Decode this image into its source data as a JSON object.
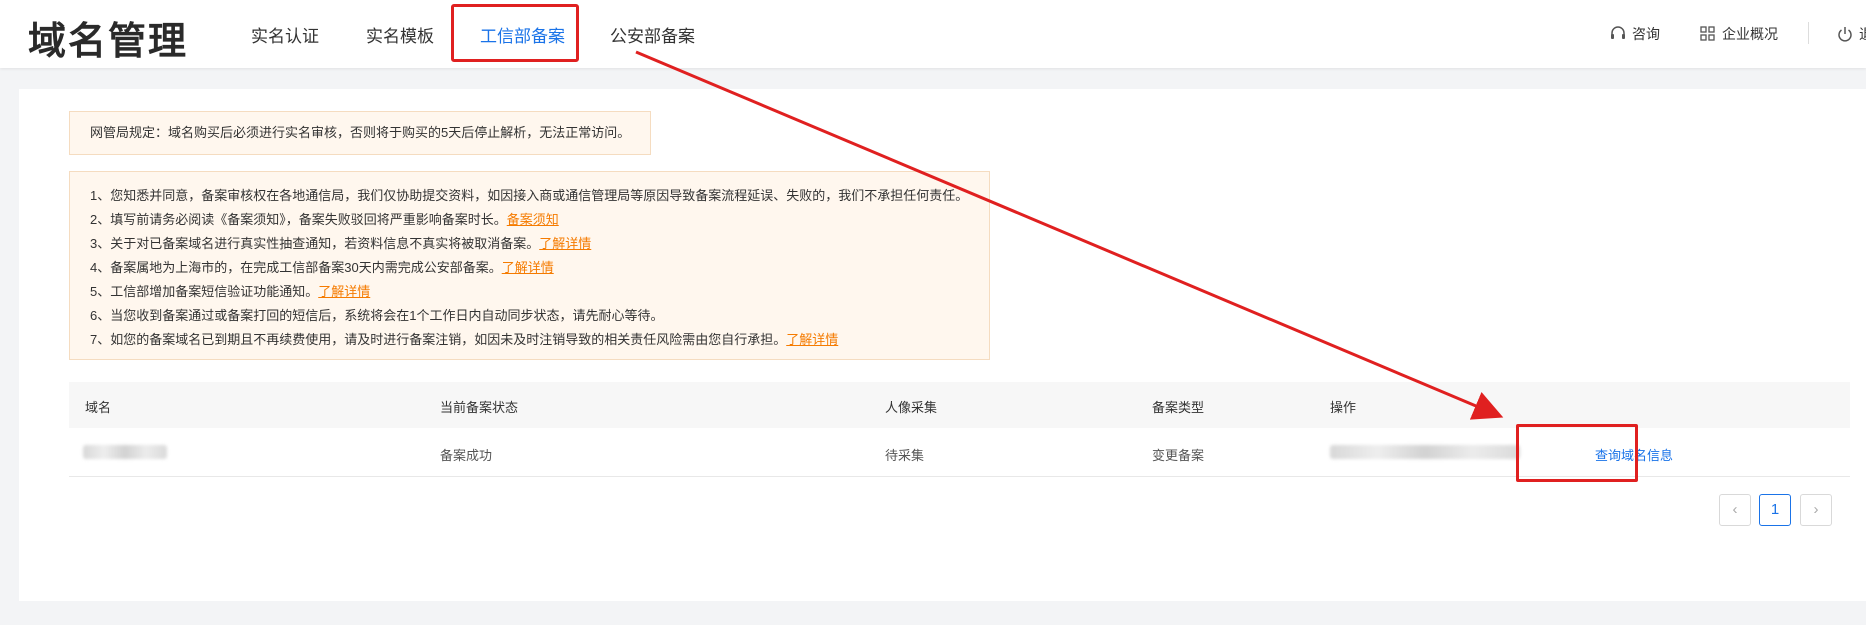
{
  "header": {
    "logo": "域名管理",
    "tabs": [
      {
        "label": "实名认证",
        "active": false
      },
      {
        "label": "实名模板",
        "active": false
      },
      {
        "label": "工信部备案",
        "active": true
      },
      {
        "label": "公安部备案",
        "active": false
      }
    ],
    "right": {
      "consult_label": "咨询",
      "overview_label": "企业概况",
      "logout_label": "退"
    }
  },
  "notice_short": "网管局规定：域名购买后必须进行实名审核，否则将于购买的5天后停止解析，无法正常访问。",
  "notice_list": [
    {
      "text": "1、您知悉并同意，备案审核权在各地通信局，我们仅协助提交资料，如因接入商或通信管理局等原因导致备案流程延误、失败的，我们不承担任何责任。",
      "link": ""
    },
    {
      "text": "2、填写前请务必阅读《备案须知》，备案失败驳回将严重影响备案时长。",
      "link": "备案须知"
    },
    {
      "text": "3、关于对已备案域名进行真实性抽查通知，若资料信息不真实将被取消备案。",
      "link": "了解详情"
    },
    {
      "text": "4、备案属地为上海市的，在完成工信部备案30天内需完成公安部备案。",
      "link": "了解详情"
    },
    {
      "text": "5、工信部增加备案短信验证功能通知。",
      "link": "了解详情"
    },
    {
      "text": "6、当您收到备案通过或备案打回的短信后，系统将会在1个工作日内自动同步状态，请先耐心等待。",
      "link": ""
    },
    {
      "text": "7、如您的备案域名已到期且不再续费使用，请及时进行备案注销，如因未及时注销导致的相关责任风险需由您自行承担。",
      "link": "了解详情"
    }
  ],
  "table": {
    "columns": [
      "域名",
      "当前备案状态",
      "人像采集",
      "备案类型",
      "操作"
    ],
    "rows": [
      {
        "domain": "",
        "status": "备案成功",
        "portrait": "待采集",
        "type": "变更备案",
        "action_link": "查询域名信息"
      }
    ]
  },
  "pagination": {
    "prev": "‹",
    "current": "1",
    "next": "›"
  },
  "colors": {
    "accent": "#1a73e8",
    "annotation": "#e02020",
    "link_orange": "#f57b00"
  }
}
